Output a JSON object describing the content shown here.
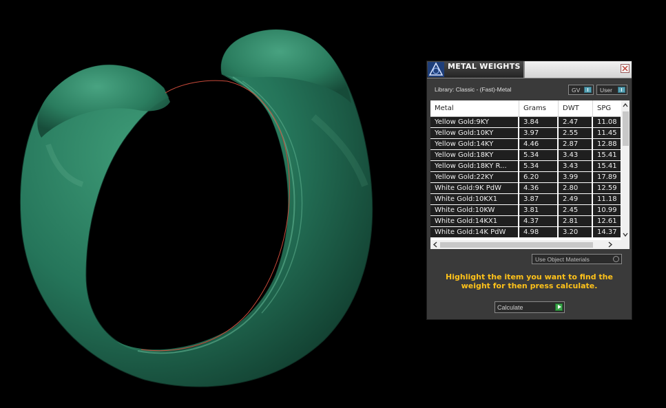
{
  "panel": {
    "title": "METAL WEIGHTS",
    "library_label": "Library: Classic - (Fast)-Metal",
    "toggles": {
      "gv": "GV",
      "user": "User"
    },
    "columns": [
      "Metal",
      "Grams",
      "DWT",
      "SPG"
    ],
    "rows": [
      {
        "metal": "Yellow Gold:9KY",
        "grams": "3.84",
        "dwt": "2.47",
        "spg": "11.08"
      },
      {
        "metal": "Yellow Gold:10KY",
        "grams": "3.97",
        "dwt": "2.55",
        "spg": "11.45"
      },
      {
        "metal": "Yellow Gold:14KY",
        "grams": "4.46",
        "dwt": "2.87",
        "spg": "12.88"
      },
      {
        "metal": "Yellow Gold:18KY",
        "grams": "5.34",
        "dwt": "3.43",
        "spg": "15.41"
      },
      {
        "metal": "Yellow Gold:18KY R...",
        "grams": "5.34",
        "dwt": "3.43",
        "spg": "15.41"
      },
      {
        "metal": "Yellow Gold:22KY",
        "grams": "6.20",
        "dwt": "3.99",
        "spg": "17.89"
      },
      {
        "metal": "White Gold:9K PdW",
        "grams": "4.36",
        "dwt": "2.80",
        "spg": "12.59"
      },
      {
        "metal": "White Gold:10KX1",
        "grams": "3.87",
        "dwt": "2.49",
        "spg": "11.18"
      },
      {
        "metal": "White Gold:10KW",
        "grams": "3.81",
        "dwt": "2.45",
        "spg": "10.99"
      },
      {
        "metal": "White Gold:14KX1",
        "grams": "4.37",
        "dwt": "2.81",
        "spg": "12.61"
      },
      {
        "metal": "White Gold:14K PdW",
        "grams": "4.98",
        "dwt": "3.20",
        "spg": "14.37"
      }
    ],
    "use_object_materials_label": "Use Object Materials",
    "instruction": "Highlight the item you want to find the weight for then press calculate.",
    "calculate_label": "Calculate"
  },
  "colors": {
    "ring_green": "#2f8a66",
    "highlight_text": "#ffc21a",
    "toggle_accent": "#5aa3b5",
    "calculate_accent": "#3aa54a"
  }
}
